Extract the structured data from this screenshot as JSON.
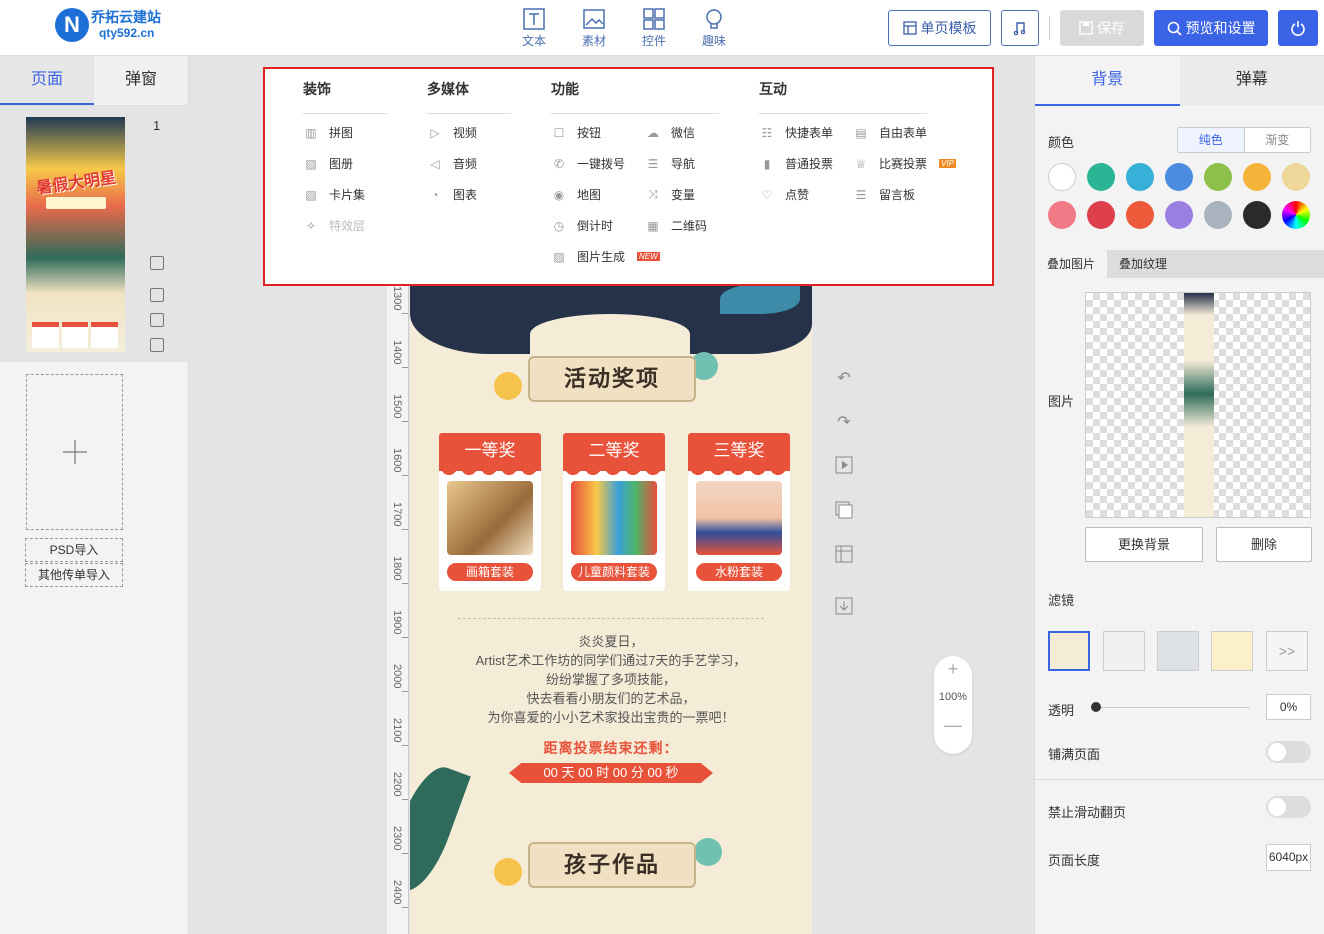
{
  "brand": {
    "name": "乔拓云建站",
    "url": "qty592.cn"
  },
  "top_tools": [
    {
      "label": "文本",
      "icon": "text-icon"
    },
    {
      "label": "素材",
      "icon": "image-icon"
    },
    {
      "label": "控件",
      "icon": "widgets-icon"
    },
    {
      "label": "趣味",
      "icon": "bulb-icon"
    }
  ],
  "toolbar": {
    "template_label": "单页模板",
    "music_icon": "music-note-icon",
    "save_label": "保存",
    "preview_label": "预览和设置",
    "power_icon": "power-icon"
  },
  "left": {
    "tabs": [
      "页面",
      "弹窗"
    ],
    "page_number": "1",
    "thumb_title": "暑假大明星",
    "psd_import": "PSD导入",
    "other_import": "其他传单导入"
  },
  "controls_menu": {
    "decoration": {
      "title": "装饰",
      "items": [
        "拼图",
        "图册",
        "卡片集",
        "特效层"
      ]
    },
    "media": {
      "title": "多媒体",
      "items": [
        "视频",
        "音频",
        "图表"
      ]
    },
    "function": {
      "title": "功能",
      "items": [
        "按钮",
        "一键拨号",
        "地图",
        "倒计时",
        "图片生成",
        "微信",
        "导航",
        "变量",
        "二维码"
      ],
      "new_tag": "NEW"
    },
    "interactive": {
      "title": "互动",
      "items": [
        "快捷表单",
        "普通投票",
        "点赞",
        "自由表单",
        "比赛投票",
        "留言板"
      ],
      "vip_tag": "VIP"
    }
  },
  "poster": {
    "banner1": "活动奖项",
    "prizes": [
      {
        "rank": "一等奖",
        "name": "画箱套装"
      },
      {
        "rank": "二等奖",
        "name": "儿童颜料套装"
      },
      {
        "rank": "三等奖",
        "name": "水粉套装"
      }
    ],
    "text_lines": [
      "炎炎夏日，",
      "Artist艺术工作坊的同学们通过7天的手艺学习，",
      "纷纷掌握了多项技能，",
      "快去看看小朋友们的艺术品，",
      "为你喜爱的小小艺术家投出宝贵的一票吧！"
    ],
    "countdown_title": "距离投票结束还剩：",
    "countdown": "00 天 00 时 00 分 00 秒",
    "banner2": "孩子作品"
  },
  "ruler_labels": [
    "1300",
    "1400",
    "1500",
    "1600",
    "1700",
    "1800",
    "1900",
    "2000",
    "2100",
    "2200",
    "2300",
    "2400"
  ],
  "zoom": {
    "plus": "+",
    "value": "100%",
    "minus": "—"
  },
  "right": {
    "tabs": [
      "背景",
      "弹幕"
    ],
    "color_label": "颜色",
    "color_modes": [
      "纯色",
      "渐变"
    ],
    "swatches": [
      "#ffffff",
      "#2bb594",
      "#36b0d8",
      "#4a8de0",
      "#8cc04b",
      "#f5b43a",
      "#efd79a",
      "#f27a86",
      "#de3f4d",
      "#ec5a3a",
      "#9a7ee0",
      "#a9b3bd",
      "#2a2a2a",
      "rainbow"
    ],
    "subtabs": [
      "叠加图片",
      "叠加纹理"
    ],
    "image_label": "图片",
    "replace_bg": "更换背景",
    "delete": "删除",
    "filter_label": "滤镜",
    "filter_more": ">>",
    "opacity_label": "透明",
    "opacity_value": "0%",
    "fill_page_label": "铺满页面",
    "no_swipe_label": "禁止滑动翻页",
    "page_length_label": "页面长度",
    "page_length_value": "6040px"
  }
}
